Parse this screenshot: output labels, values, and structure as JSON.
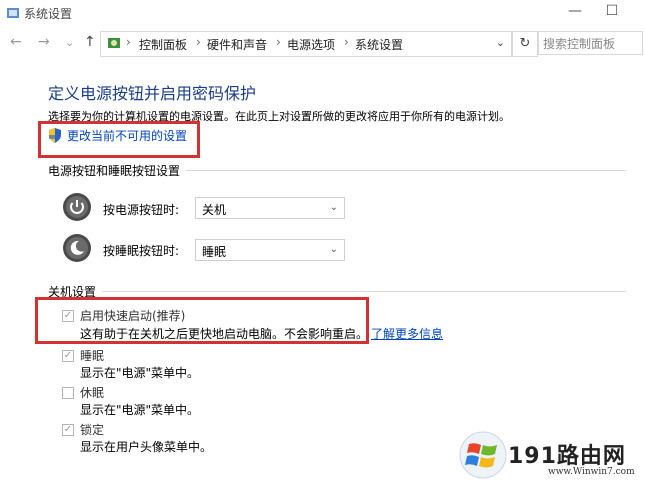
{
  "window": {
    "title": "系统设置",
    "minimize_glyph": "—",
    "maximize_glyph": "☐"
  },
  "nav": {
    "back_glyph": "←",
    "forward_glyph": "→",
    "history_glyph": "⌄",
    "up_glyph": "↑",
    "breadcrumbs": [
      "控制面板",
      "硬件和声音",
      "电源选项",
      "系统设置"
    ],
    "separator": "›",
    "address_dropdown_glyph": "⌄",
    "refresh_glyph": "↻",
    "search_placeholder": "搜索控制面板"
  },
  "main": {
    "heading": "定义电源按钮并启用密码保护",
    "description": "选择要为你的计算机设置的电源设置。在此页上对设置所做的更改将应用于你所有的电源计划。",
    "change_link": "更改当前不可用的设置"
  },
  "power_section": {
    "label": "电源按钮和睡眠按钮设置",
    "rows": [
      {
        "label": "按电源按钮时:",
        "value": "关机"
      },
      {
        "label": "按睡眠按钮时:",
        "value": "睡眠"
      }
    ]
  },
  "shutdown_section": {
    "label": "关机设置",
    "options": [
      {
        "title": "启用快速启动(推荐)",
        "desc": "这有助于在关机之后更快地启动电脑。不会影响重启。",
        "link": "了解更多信息",
        "checked": true
      },
      {
        "title": "睡眠",
        "desc": "显示在\"电源\"菜单中。",
        "checked": true
      },
      {
        "title": "休眠",
        "desc": "显示在\"电源\"菜单中。",
        "checked": false
      },
      {
        "title": "锁定",
        "desc": "显示在用户头像菜单中。",
        "checked": true
      }
    ]
  },
  "watermark": {
    "brand": "191路由网",
    "url": "www.Winwin7.com"
  },
  "colors": {
    "heading": "#1a3e8a",
    "link": "#0044bb",
    "highlight_box": "#d23232"
  }
}
